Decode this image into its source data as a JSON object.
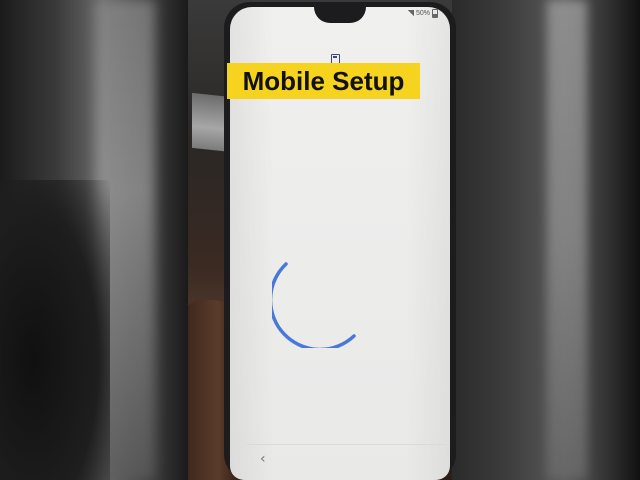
{
  "overlay": {
    "title": "Mobile Setup"
  },
  "status_bar": {
    "battery_percent": "50%"
  },
  "loading": {
    "spinner_color": "#3a6fd6"
  },
  "navigation": {
    "back_glyph": "‹"
  },
  "icons": {
    "setup": "setup-device-icon",
    "back": "back-chevron-icon",
    "signal": "signal-icon",
    "battery": "battery-icon"
  },
  "colors": {
    "banner": "#f5d31f",
    "screen_bg": "#eeeeed",
    "spinner": "#3a6fd6"
  }
}
